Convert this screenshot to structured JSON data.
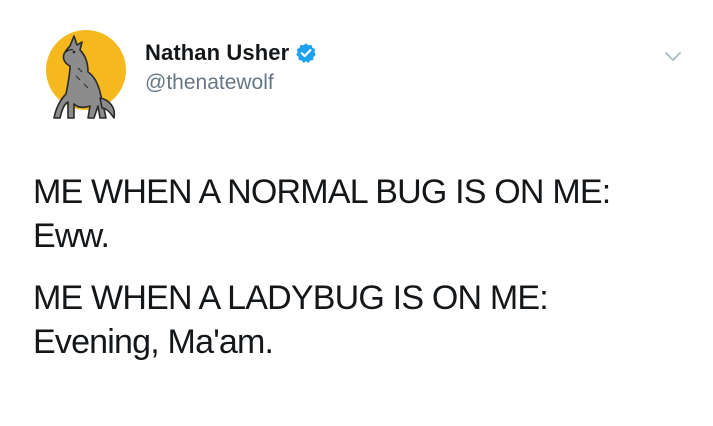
{
  "author": {
    "display_name": "Nathan Usher",
    "handle": "@thenatewolf",
    "verified": true,
    "avatar_icon": "howling-wolf-moon-avatar",
    "accent_moon": "#F5B91E",
    "verified_color": "#1DA1F2"
  },
  "tweet": {
    "lines": [
      "ME WHEN A NORMAL BUG IS ON ME:",
      "Eww.",
      "ME WHEN A LADYBUG IS ON ME:",
      "Evening, Ma'am."
    ]
  },
  "controls": {
    "menu_icon": "chevron-down-icon"
  }
}
